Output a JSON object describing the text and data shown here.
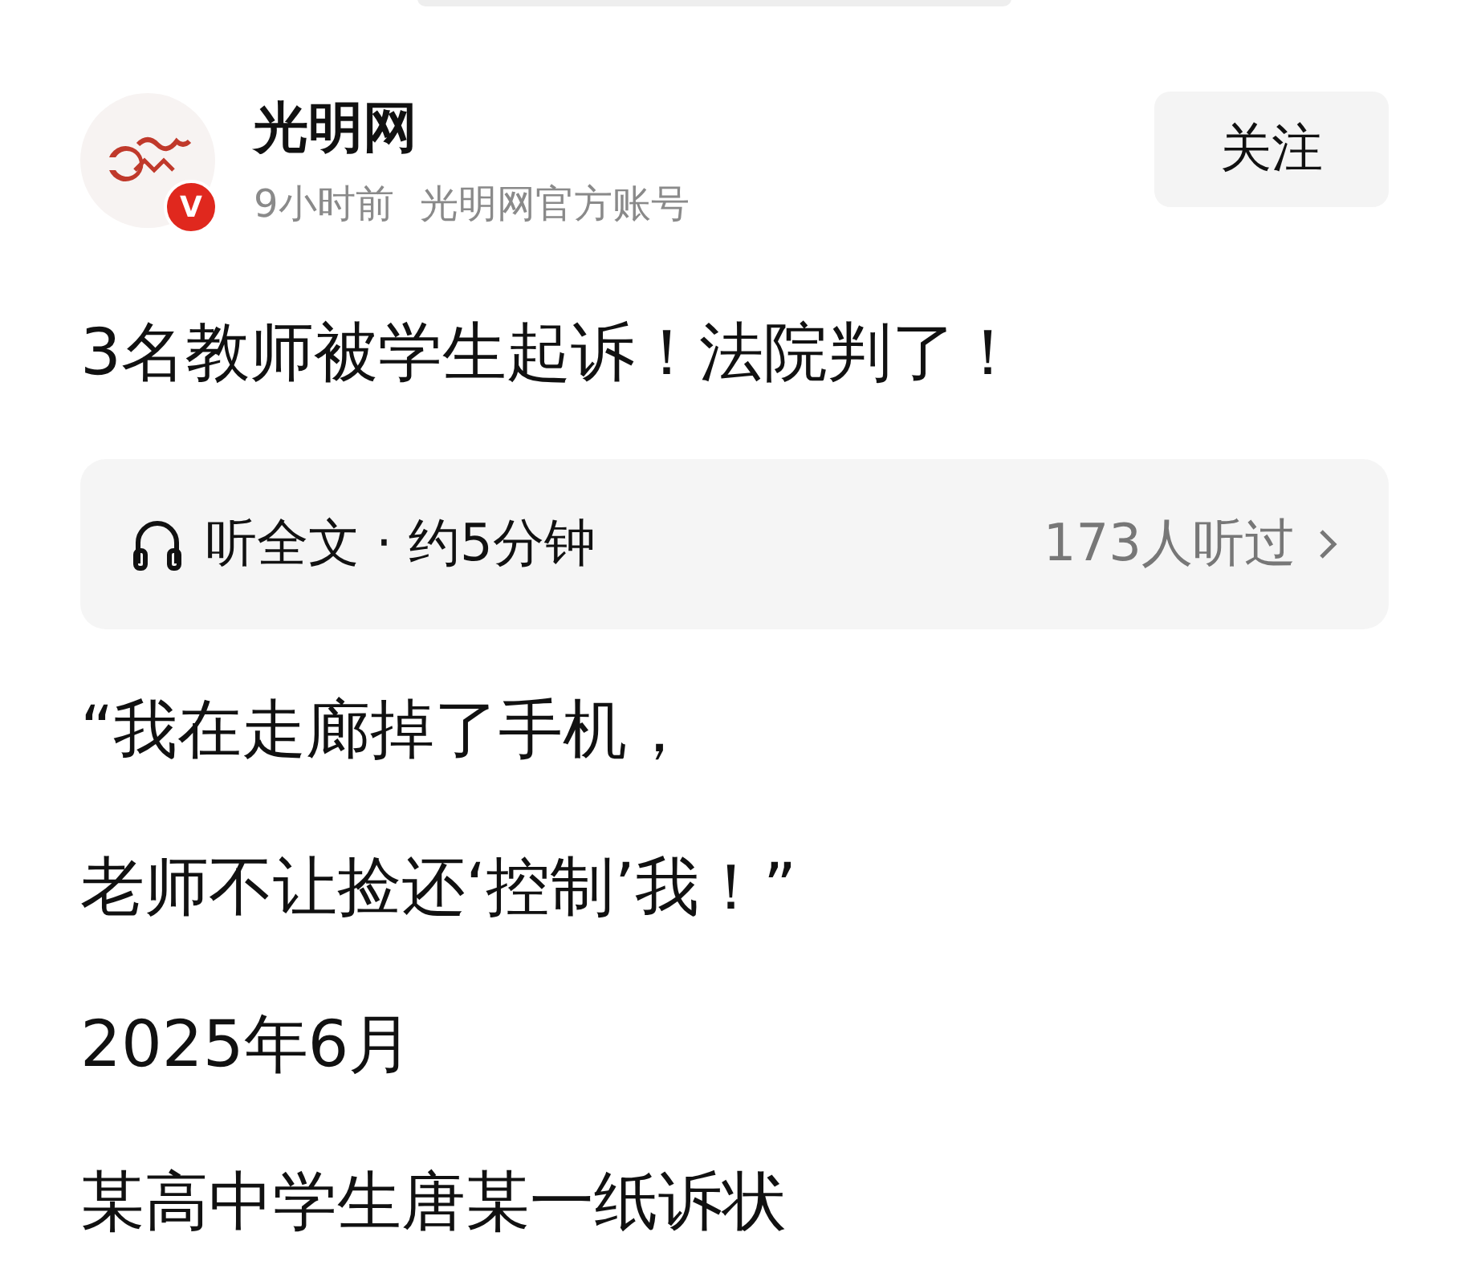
{
  "account": {
    "name": "光明网",
    "verified_badge": "V",
    "time": "9小时前",
    "description": "光明网官方账号",
    "follow_button": "关注"
  },
  "article": {
    "title": "3名教师被学生起诉！法院判了！",
    "listen": {
      "label": "听全文 · 约5分钟",
      "count": "173人听过"
    },
    "paragraphs": [
      "“我在走廊掉了手机，",
      "老师不让捡还‘控制’我！”",
      "2025年6月",
      "某高中学生唐某一纸诉状"
    ]
  }
}
